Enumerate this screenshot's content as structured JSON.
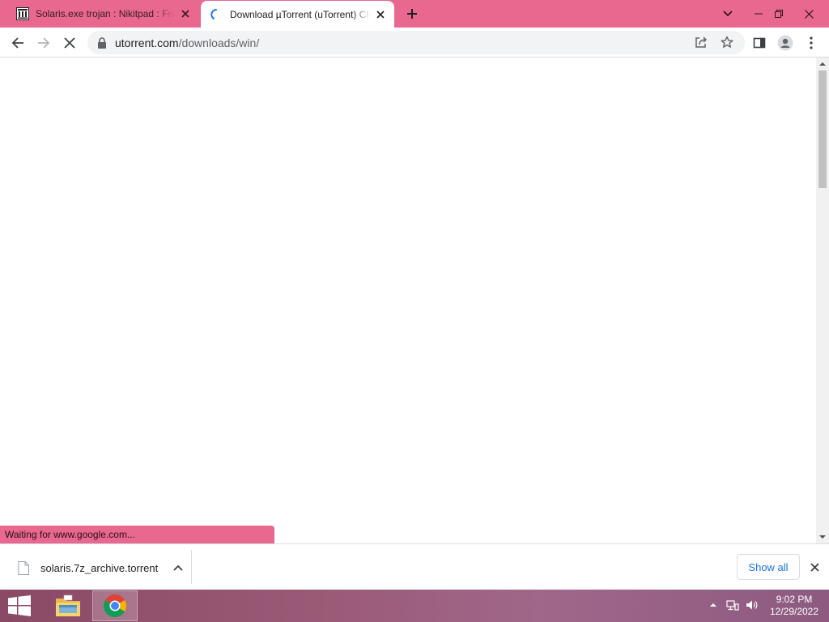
{
  "browser": {
    "tabs": [
      {
        "title": "Solaris.exe trojan : Nikitpad : Free Download",
        "favicon": "library-icon",
        "active": false
      },
      {
        "title": "Download µTorrent (uTorrent) Client",
        "favicon": "loading-spinner-icon",
        "active": true
      }
    ],
    "url": {
      "host": "utorrent.com",
      "path": "/downloads/win/"
    },
    "status_text": "Waiting for www.google.com..."
  },
  "downloads": {
    "items": [
      {
        "filename": "solaris.7z_archive.torrent"
      }
    ],
    "show_all_label": "Show all"
  },
  "taskbar": {
    "apps": [
      "file-explorer-icon",
      "chrome-icon"
    ],
    "clock_time": "9:02 PM",
    "clock_date": "12/29/2022"
  },
  "colors": {
    "accent_frame": "#e8688f",
    "link_blue": "#1a73e8"
  }
}
